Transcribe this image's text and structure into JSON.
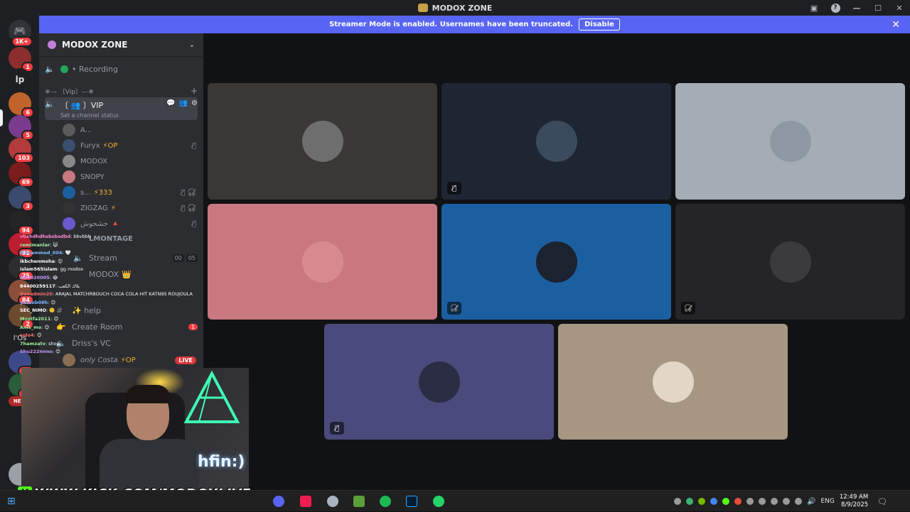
{
  "window": {
    "title": "MODOX ZONE"
  },
  "banner": {
    "text": "Streamer Mode is enabled. Usernames have been truncated.",
    "button": "Disable"
  },
  "guildbar": {
    "top_badge": "1K+",
    "text_server": "lp",
    "badges": [
      "1",
      "6",
      "5",
      "103",
      "69",
      "3",
      "94",
      "92",
      "75",
      "84",
      "2",
      "17",
      "28"
    ],
    "partial_label": "l'Os",
    "new_label": "NEW"
  },
  "server": {
    "name": "MODOX ZONE",
    "channels": {
      "recording": "• Recording",
      "vip_category": "✵·-- 〔Vip〕--·✵",
      "vip_channel": "〔 👥 〕VIP",
      "vip_status": "Set a channel status",
      "montage": "LMONTAGE",
      "stream": "Stream",
      "stream_counts": [
        "00",
        "05"
      ],
      "modox": "MODOX",
      "help": "✨ help",
      "create_room": "Create Room",
      "create_room_badge": "1",
      "driss": "Driss's VC",
      "only_costa": "only Costa",
      "only_costa_tag": "⚡OP",
      "live": "LIVE"
    },
    "members": [
      {
        "name": "A...",
        "tag": ""
      },
      {
        "name": "Furyx",
        "tag": "⚡OP"
      },
      {
        "name": "MODOX",
        "tag": ""
      },
      {
        "name": "SNOPY",
        "tag": ""
      },
      {
        "name": "s...",
        "tag": "⚡333"
      },
      {
        "name": "ZIGZAG",
        "tag": "⚡"
      },
      {
        "name": "حشحوش",
        "tag": "🔺"
      }
    ]
  },
  "chat_overlay": [
    {
      "user": "vbxhdhdhsbsbsdbd",
      "msg": ": bbvbbb"
    },
    {
      "user": "remimanlar",
      "msg": ": 😺"
    },
    {
      "user": "Mohammed_004",
      "msg": ": 🤍"
    },
    {
      "user": "ikbchenmoha",
      "msg": ": 😊"
    },
    {
      "user": "islam565islam",
      "msg": ": gg modox"
    },
    {
      "user": "AB0020005",
      "msg": ": 😂"
    },
    {
      "user": "84400259117",
      "msg": ": يلاك الكعب"
    },
    {
      "user": "Daxadmin20",
      "msg": ": ARAJAL MATCHRBOUCH COCA COLA HIT KATN9S ROUJOULA"
    },
    {
      "user": "yassob08h",
      "msg": ": 😊"
    },
    {
      "user": "SEC_NIMO",
      "msg": ": 🙂"
    },
    {
      "user": "Mostfa2011",
      "msg": ": 😊"
    },
    {
      "user": "Anis_mo",
      "msg": ": 😊"
    },
    {
      "user": "solo4",
      "msg": ": 😊"
    },
    {
      "user": "7hamzatv",
      "msg": ": shop"
    },
    {
      "user": "Shu222nnno",
      "msg": ": 😊"
    }
  ],
  "overlay_text": {
    "kick_url": "WWW.KICK.COM/MODOXLIVE",
    "neon_sign": "hfin:)"
  },
  "tiles": [
    {
      "bg": "#3a3735",
      "indicator": ""
    },
    {
      "bg": "#1f2633",
      "indicator": "mic-off"
    },
    {
      "bg": "#a4adb6",
      "indicator": ""
    },
    {
      "bg": "#c9787f",
      "indicator": ""
    },
    {
      "bg": "#1c5fa1",
      "indicator": "deafened"
    },
    {
      "bg": "#252426",
      "indicator": "deafened"
    },
    {
      "bg": "#4b4a7c",
      "indicator": "mic-off"
    },
    {
      "bg": "#a79682",
      "indicator": ""
    }
  ],
  "taskbar": {
    "lang": "ENG",
    "time": "12:49 AM",
    "date": "8/9/2025"
  },
  "colors": {
    "blurple": "#5865f2",
    "kick_green": "#53fc18",
    "live_red": "#da373c"
  }
}
